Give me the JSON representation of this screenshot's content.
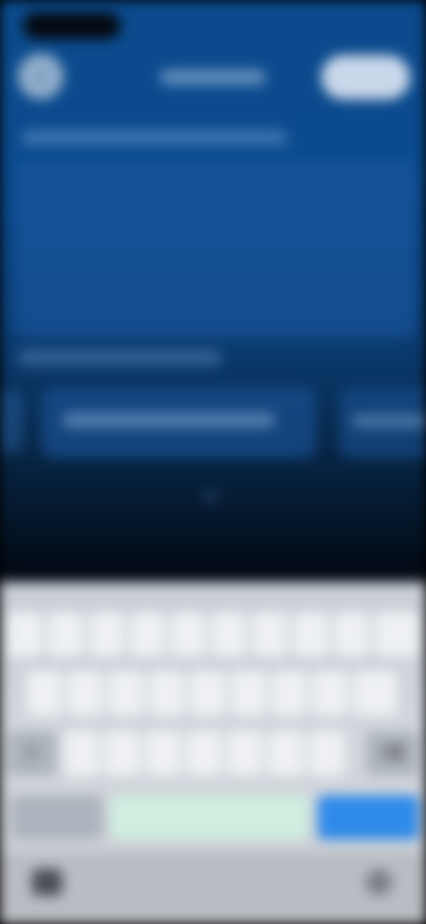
{
  "header": {
    "back_icon": "chevron-left-icon",
    "title": "",
    "action_label": ""
  },
  "keyboard": {
    "row1": [
      "",
      "",
      "",
      "",
      "",
      "",
      "",
      "",
      "",
      ""
    ],
    "row2": [
      "",
      "",
      "",
      "",
      "",
      "",
      "",
      "",
      ""
    ],
    "row3": [
      "",
      "",
      "",
      "",
      "",
      "",
      "",
      ""
    ],
    "space_label": "",
    "enter_label": ""
  },
  "colors": {
    "app_background": "#0b4a8c",
    "keyboard_background": "#d3d7dd",
    "enter_key": "#2f8aea",
    "space_key": "#cfeee0"
  }
}
